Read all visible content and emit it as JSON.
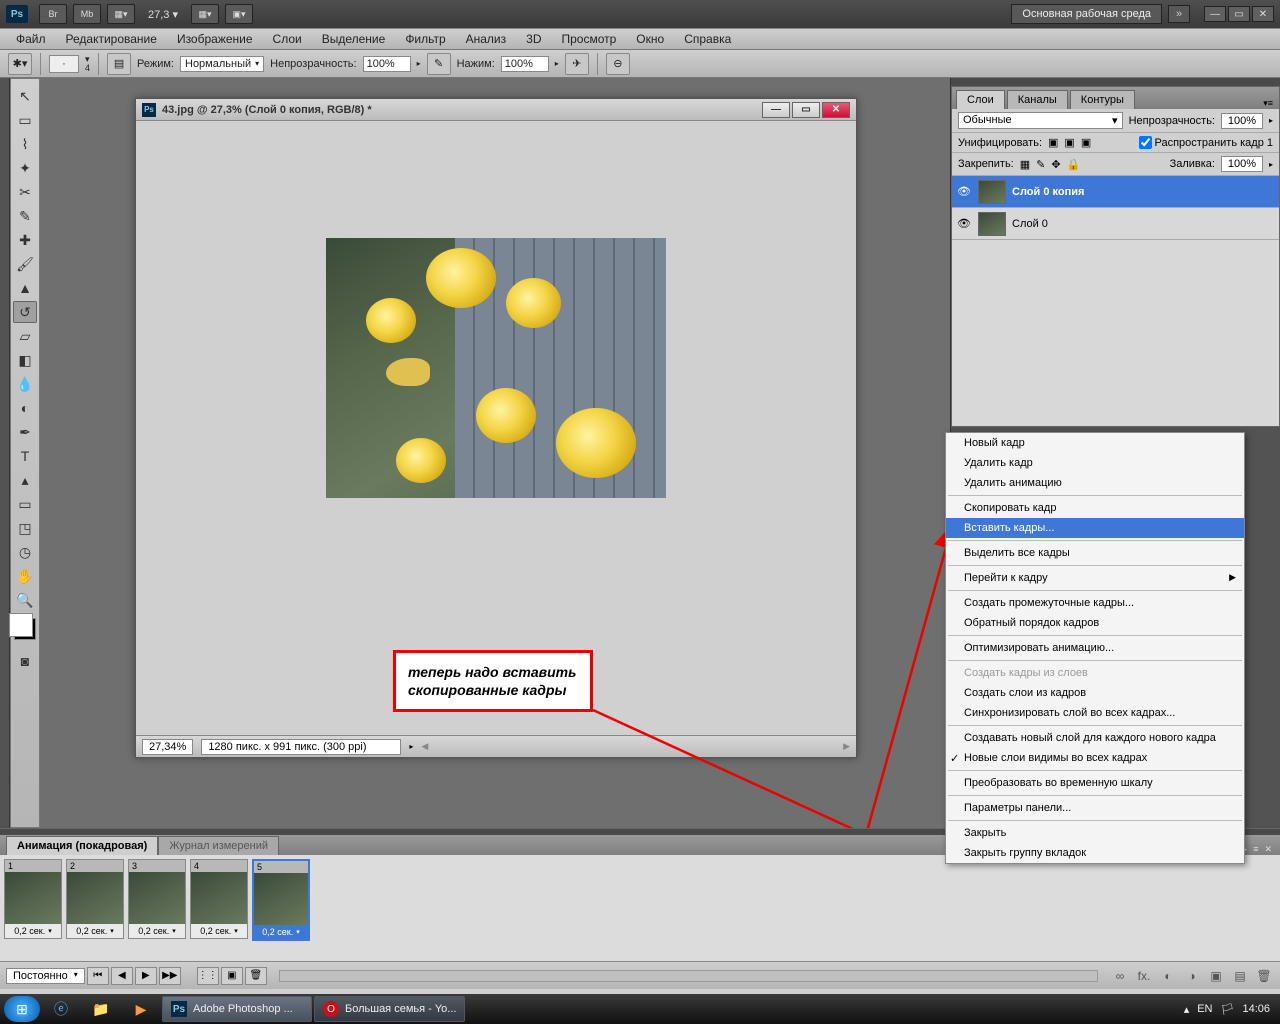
{
  "topbar": {
    "zoom_display": "27,3",
    "workspace_label": "Основная рабочая среда"
  },
  "menu": {
    "file": "Файл",
    "edit": "Редактирование",
    "image": "Изображение",
    "layer": "Слои",
    "select": "Выделение",
    "filter": "Фильтр",
    "analysis": "Анализ",
    "three_d": "3D",
    "view": "Просмотр",
    "window": "Окно",
    "help": "Справка"
  },
  "options": {
    "size_val": "4",
    "mode_label": "Режим:",
    "mode_value": "Нормальный",
    "opacity_label": "Непрозрачность:",
    "opacity_value": "100%",
    "flow_label": "Нажим:",
    "flow_value": "100%"
  },
  "document": {
    "title": "43.jpg @ 27,3% (Слой 0 копия, RGB/8) *",
    "status_zoom": "27,34%",
    "status_info": "1280 пикс. x 991 пикс. (300 ppi)"
  },
  "annotation": {
    "text": "теперь надо вставить скопированные кадры"
  },
  "layers_panel": {
    "tabs": {
      "layers": "Слои",
      "channels": "Каналы",
      "paths": "Контуры"
    },
    "blend_mode": "Обычные",
    "opacity_label": "Непрозрачность:",
    "opacity_value": "100%",
    "unify_label": "Унифицировать:",
    "propagate_label": "Распространить кадр 1",
    "lock_label": "Закрепить:",
    "fill_label": "Заливка:",
    "fill_value": "100%",
    "layer1": "Слой 0 копия",
    "layer2": "Слой 0"
  },
  "context_menu": {
    "new_frame": "Новый кадр",
    "delete_frame": "Удалить кадр",
    "delete_anim": "Удалить анимацию",
    "copy_frame": "Скопировать кадр",
    "paste_frames": "Вставить кадры...",
    "select_all": "Выделить все кадры",
    "goto": "Перейти к кадру",
    "tween": "Создать промежуточные кадры...",
    "reverse": "Обратный порядок кадров",
    "optimize": "Оптимизировать анимацию...",
    "frames_from_layers": "Создать кадры из слоев",
    "layers_from_frames": "Создать слои из кадров",
    "sync_layer": "Синхронизировать слой во всех кадрах...",
    "new_layer_each": "Создавать новый слой для каждого нового кадра",
    "new_layers_visible": "Новые слои видимы во всех кадрах",
    "convert_timeline": "Преобразовать во временную шкалу",
    "panel_opts": "Параметры панели...",
    "close": "Закрыть",
    "close_group": "Закрыть группу вкладок"
  },
  "animation": {
    "tab_frames": "Анимация (покадровая)",
    "tab_log": "Журнал измерений",
    "frame_time": "0,2 сек.",
    "loop": "Постоянно",
    "frames": [
      "1",
      "2",
      "3",
      "4",
      "5"
    ]
  },
  "taskbar": {
    "app_ps": "Adobe Photoshop ...",
    "app_opera": "Большая семья - Yo...",
    "lang": "EN",
    "clock": "14:06"
  }
}
